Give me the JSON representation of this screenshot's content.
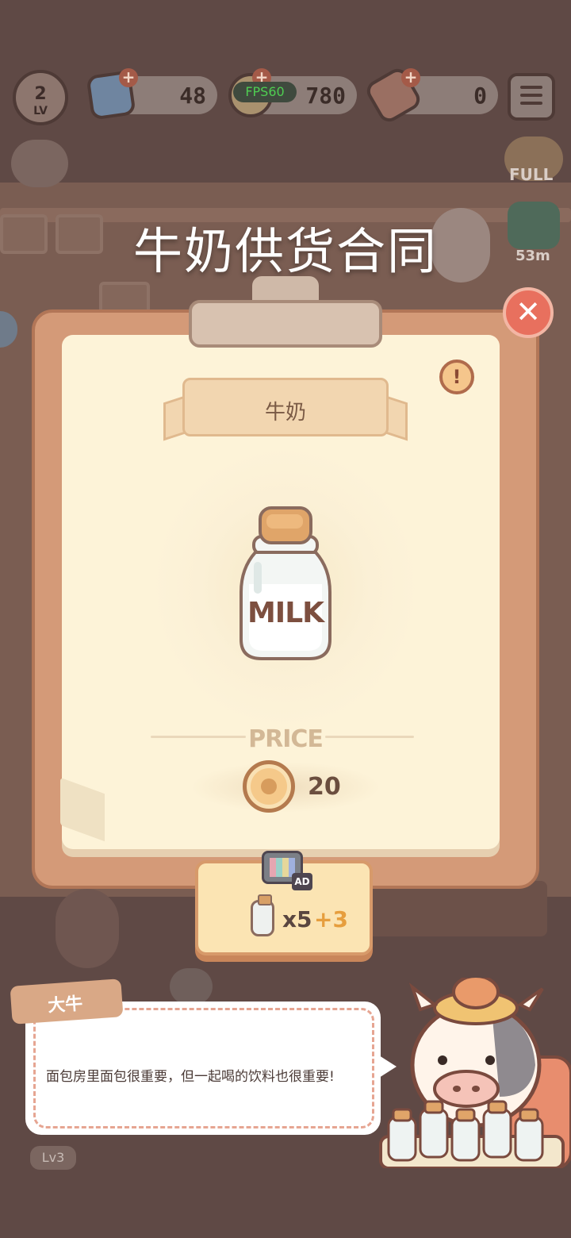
{
  "hud": {
    "level": "2",
    "level_label": "LV",
    "gems": "48",
    "fps": "FPS60",
    "coins": "780",
    "tickets": "0",
    "full_label": "FULL",
    "timer": "53m"
  },
  "popup": {
    "title": "牛奶供货合同",
    "item_name": "牛奶",
    "item_label": "MILK",
    "price_label": "PRICE",
    "price": "20",
    "ad_tag": "AD",
    "ad_quantity": "x5",
    "ad_bonus": "+3"
  },
  "dialog": {
    "speaker": "大牛",
    "text": "面包房里面包很重要，但一起喝的饮料也很重要!"
  },
  "background": {
    "level_tag": "Lv3"
  },
  "colors": {
    "board": "#d49a78",
    "paper": "#fdf3d8",
    "close_button": "#e8705e",
    "ad_button": "#fbe4b3"
  },
  "icons": [
    "gem-icon",
    "coin-icon",
    "ticket-icon",
    "menu-icon",
    "close-icon",
    "warning-icon",
    "milk-bottle-icon",
    "tv-ad-icon"
  ]
}
